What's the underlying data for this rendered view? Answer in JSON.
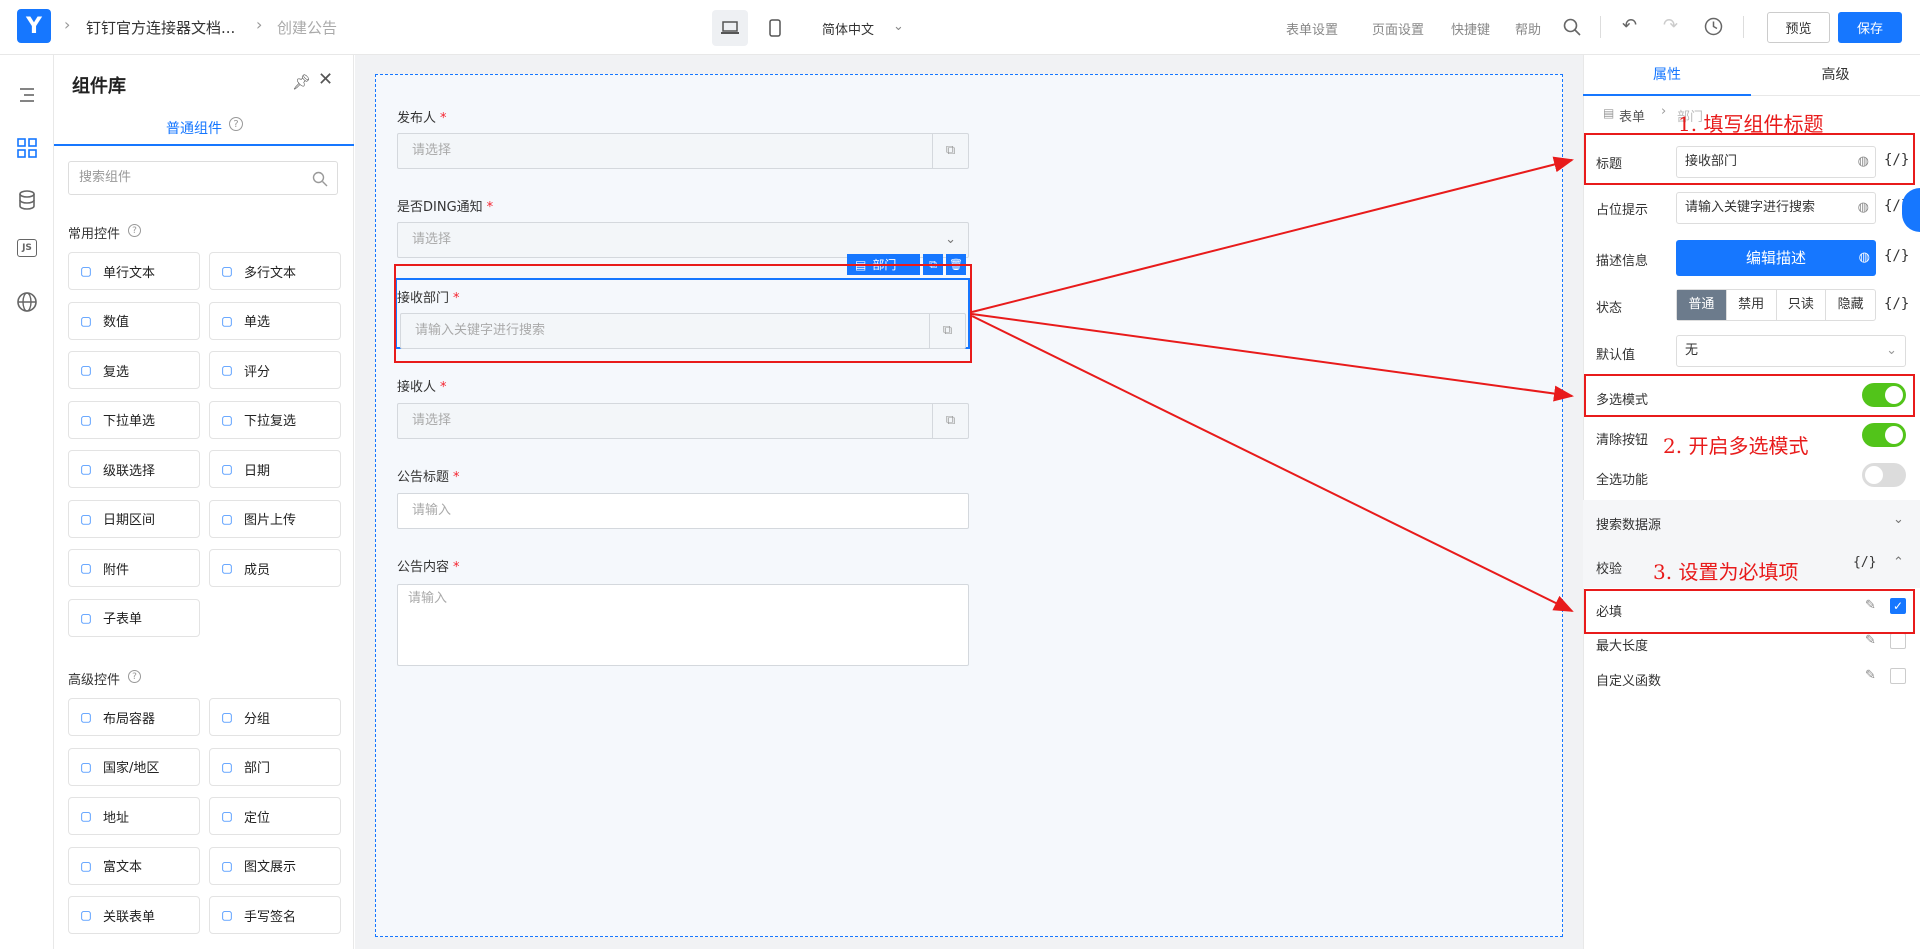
{
  "topbar": {
    "breadcrumb": [
      "钉钉官方连接器文档...",
      "创建公告"
    ],
    "language": "简体中文",
    "links": [
      "表单设置",
      "页面设置",
      "快捷键",
      "帮助"
    ],
    "preview_label": "预览",
    "save_label": "保存"
  },
  "component_panel": {
    "title": "组件库",
    "tab": "普通组件",
    "search_placeholder": "搜索组件",
    "common_title": "常用控件",
    "common": [
      {
        "label": "单行文本",
        "icon": "text-icon"
      },
      {
        "label": "多行文本",
        "icon": "textarea-icon"
      },
      {
        "label": "数值",
        "icon": "number-icon"
      },
      {
        "label": "单选",
        "icon": "radio-icon"
      },
      {
        "label": "复选",
        "icon": "checkbox-icon"
      },
      {
        "label": "评分",
        "icon": "star-icon"
      },
      {
        "label": "下拉单选",
        "icon": "select-icon"
      },
      {
        "label": "下拉复选",
        "icon": "multiselect-icon"
      },
      {
        "label": "级联选择",
        "icon": "cascade-icon"
      },
      {
        "label": "日期",
        "icon": "calendar-icon"
      },
      {
        "label": "日期区间",
        "icon": "date-range-icon"
      },
      {
        "label": "图片上传",
        "icon": "image-icon"
      },
      {
        "label": "附件",
        "icon": "paperclip-icon"
      },
      {
        "label": "成员",
        "icon": "user-icon"
      },
      {
        "label": "子表单",
        "icon": "subform-icon"
      }
    ],
    "advanced_title": "高级控件",
    "advanced": [
      {
        "label": "布局容器",
        "icon": "layout-icon"
      },
      {
        "label": "分组",
        "icon": "group-icon"
      },
      {
        "label": "国家/地区",
        "icon": "globe-icon"
      },
      {
        "label": "部门",
        "icon": "department-icon"
      },
      {
        "label": "地址",
        "icon": "map-icon"
      },
      {
        "label": "定位",
        "icon": "location-icon"
      },
      {
        "label": "富文本",
        "icon": "richtext-icon"
      },
      {
        "label": "图文展示",
        "icon": "media-icon"
      },
      {
        "label": "关联表单",
        "icon": "link-form-icon"
      },
      {
        "label": "手写签名",
        "icon": "signature-icon"
      }
    ]
  },
  "form": {
    "fields": [
      {
        "label": "发布人",
        "placeholder": "请选择"
      },
      {
        "label": "是否DING通知",
        "placeholder": "请选择"
      },
      {
        "label": "接收部门",
        "placeholder": "请输入关键字进行搜索"
      },
      {
        "label": "接收人",
        "placeholder": "请选择"
      },
      {
        "label": "公告标题",
        "placeholder": "请输入"
      },
      {
        "label": "公告内容",
        "placeholder": "请输入"
      }
    ],
    "selected_tag": "部门"
  },
  "props": {
    "tabs": [
      "属性",
      "高级"
    ],
    "breadcrumb": [
      "表单",
      "部门"
    ],
    "title_label": "标题",
    "title_value": "接收部门",
    "placeholder_label": "占位提示",
    "placeholder_value": "请输入关键字进行搜索",
    "desc_label": "描述信息",
    "desc_button": "编辑描述",
    "state_label": "状态",
    "states": [
      "普通",
      "禁用",
      "只读",
      "隐藏"
    ],
    "default_label": "默认值",
    "default_value": "无",
    "multi_label": "多选模式",
    "clear_label": "清除按钮",
    "selectall_label": "全选功能",
    "datasource_label": "搜索数据源",
    "validate_label": "校验",
    "required_label": "必填",
    "maxlen_label": "最大长度",
    "custom_fn_label": "自定义函数",
    "code_glyph": "{/}"
  },
  "annotations": [
    "1. 填写组件标题",
    "2. 开启多选模式",
    "3. 设置为必填项"
  ]
}
